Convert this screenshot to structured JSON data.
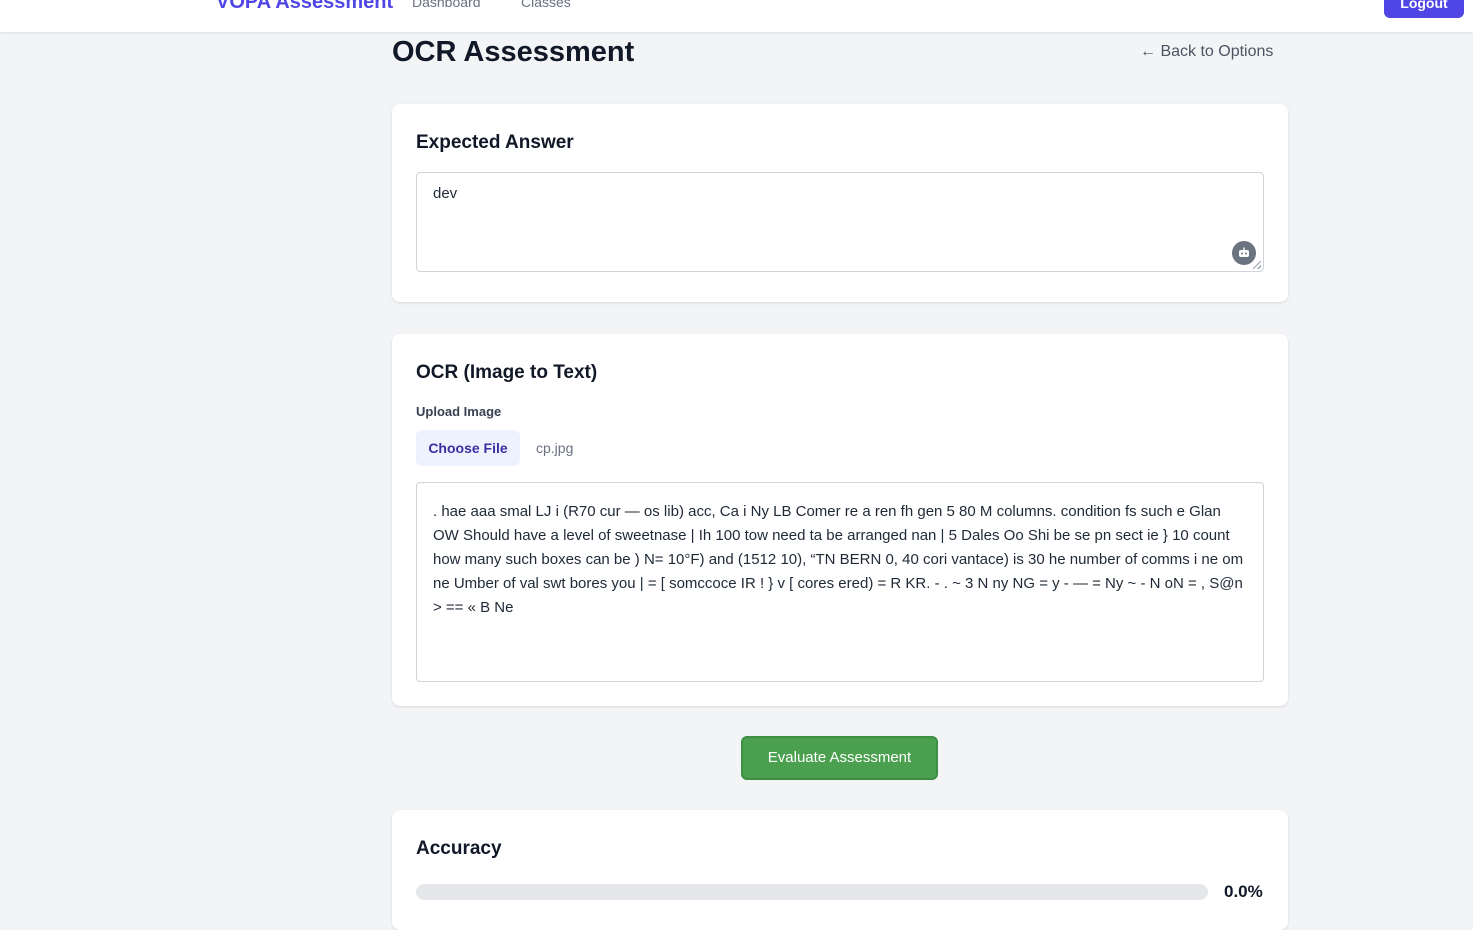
{
  "nav": {
    "brand": "VOPA Assessment",
    "dashboard_label": "Dashboard",
    "classes_label": "Classes",
    "logout_label": "Logout"
  },
  "header": {
    "title": "OCR Assessment",
    "back_label": "← Back to Options"
  },
  "expected": {
    "title": "Expected Answer",
    "value": "dev",
    "assist_icon": "robot-icon"
  },
  "ocr": {
    "title": "OCR (Image to Text)",
    "upload_label": "Upload Image",
    "choose_file_label": "Choose File",
    "file_name": "cp.jpg",
    "extracted_text": ". hae aaa smal LJ i (R70 cur — os lib) acc, Ca i Ny LB Comer re a ren fh gen 5 80 M columns. condition fs such e Glan OW Should have a level of sweetnase | Ih 100 tow need ta be arranged nan | 5 Dales Oo Shi be se pn sect ie } 10 count how many such boxes can be ) N= 10°F) and (1512 10), “TN BERN 0, 40 cori vantace) is 30 he number of comms i ne om ne Umber of val swt bores you | = [ somccoce IR ! } v [ cores ered) = R KR. - . ~ 3 N ny NG = y - — = Ny ~ - N oN = , S@n > == « B Ne"
  },
  "actions": {
    "evaluate_label": "Evaluate Assessment"
  },
  "accuracy": {
    "title": "Accuracy",
    "value_text": "0.0%",
    "fraction": 0.0
  },
  "colors": {
    "brand": "#4f46e5",
    "evaluate": "#4aa04f",
    "background": "#f3f4f6"
  }
}
